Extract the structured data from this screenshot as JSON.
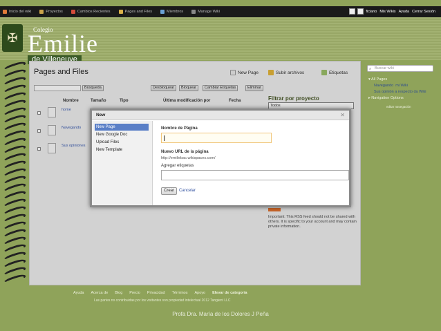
{
  "topbar": {
    "items": [
      "Inicio del wiki",
      "Proyectos",
      "Cambios Recientes",
      "Pages and Files",
      "Miembros",
      "Manage Wiki"
    ],
    "right": [
      "ficiano",
      "Mis Wikis",
      "Ayuda",
      "Cerrar Sesión"
    ]
  },
  "header": {
    "colegio": "Colegio",
    "name": "Emilie",
    "sub": "de Villeneuve"
  },
  "page": {
    "title": "Pages and Files",
    "new_page": "New Page",
    "upload": "Subir archivos",
    "tags": "Etiquetas",
    "search_button": "Búsqueda",
    "actions": [
      "Desbloquear",
      "Bloquear",
      "Cambiar Etiquetas",
      "Eliminar"
    ],
    "columns": [
      "Nombre",
      "Tamaño",
      "Tipo",
      "Última modificación por",
      "Fecha"
    ],
    "filter_label": "Filtrar por proyecto",
    "filter_value": "Todos",
    "rows": [
      "home",
      "Navegando",
      "Sus opiniones"
    ],
    "rss_important": "Important: This RSS feed should not be shared with others. It is specific to your account and may contain private information."
  },
  "sidebar": {
    "search_placeholder": "Buscar wiki",
    "all_pages": "All Pages",
    "link1": "Navegando",
    "link1b": "mi Wiki",
    "link2": "Sus opinión a respecto da Wiki",
    "nav_options": "Navigation Options",
    "edit_nav": "editar navegación"
  },
  "modal": {
    "title": "New",
    "menu": [
      "New Page",
      "New Google Doc",
      "Upload Files",
      "New Template"
    ],
    "name_label": "Nombre de Página",
    "url_label": "Nuevo URL de la página",
    "url_value": "http://emiliebac.wikispaces.com/",
    "tags_label": "Agregar etiquetas",
    "create": "Crear",
    "cancel": "Cancelar"
  },
  "footer": {
    "links": [
      "Ayuda",
      "Acerca de",
      "Blog",
      "Precio",
      "Privacidad",
      "Términos",
      "Apoyo",
      "Elevar de categoría"
    ],
    "copyright": "Las partes no contribuidas por los visitantes son propiedad intelectual 2012 Tangient LLC"
  },
  "caption": "Profa Dra. María de los Dolores J Peña"
}
